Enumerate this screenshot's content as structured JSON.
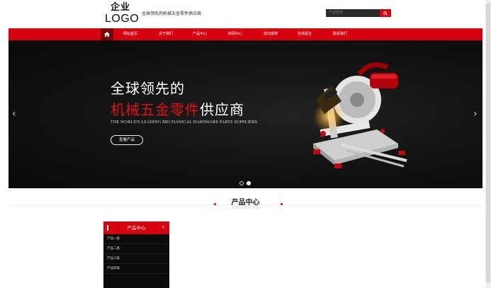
{
  "header": {
    "logo_line1": "企业",
    "logo_line2": "LOGO",
    "slogan": "全球领先的机械五金零件供应商",
    "search_placeholder": "产品搜索"
  },
  "nav": {
    "home_icon": "home-icon",
    "items": [
      "网站首页",
      "关于我们",
      "产品中心",
      "新闻中心",
      "成功案例",
      "在线留言",
      "联系我们"
    ]
  },
  "banner": {
    "headline_1": "全球领先的",
    "headline_2_red": "机械五金零件",
    "headline_2_white": "供应商",
    "subtitle_en": "THE WORLD'S LEADING MECHANICAL HARDWARE PARTS SUPPLIERS",
    "button_label": "查看产品",
    "slide_count": 2,
    "active_slide": 2,
    "prev_arrow": "‹",
    "next_arrow": "›"
  },
  "section": {
    "title": "产品中心",
    "subtitle": "PRODUCTS"
  },
  "sidebar": {
    "title": "产品中心",
    "expand_icon": "+",
    "categories": [
      "产品一类",
      "产品二类",
      "产品三类",
      "产品四类"
    ]
  },
  "colors": {
    "accent": "#d7000f",
    "dark": "#0c0c0c"
  }
}
